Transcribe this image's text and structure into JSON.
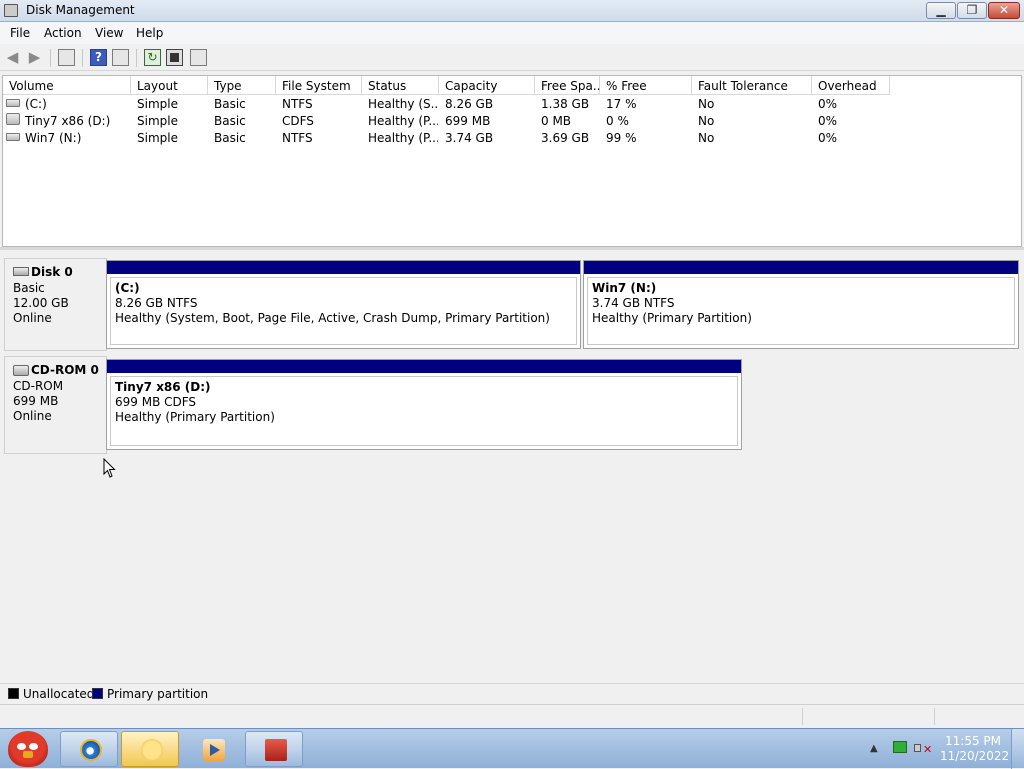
{
  "window": {
    "title": "Disk Management",
    "min_icon": "minimize-icon",
    "max_icon": "maximize-icon",
    "close_icon": "close-icon"
  },
  "menu": [
    "File",
    "Action",
    "View",
    "Help"
  ],
  "toolbar": {
    "icons": [
      "back-arrow-icon",
      "forward-arrow-icon",
      "show-hide-console-tree-icon",
      "help-icon",
      "view-icon",
      "refresh-icon",
      "properties-icon",
      "action-icon"
    ]
  },
  "volume_list": {
    "columns": [
      "Volume",
      "Layout",
      "Type",
      "File System",
      "Status",
      "Capacity",
      "Free Spa...",
      "% Free",
      "Fault Tolerance",
      "Overhead"
    ],
    "rows": [
      {
        "volume": "(C:)",
        "layout": "Simple",
        "type": "Basic",
        "fs": "NTFS",
        "status": "Healthy (S...",
        "capacity": "8.26 GB",
        "free": "1.38 GB",
        "pct": "17 %",
        "fault": "No",
        "overhead": "0%"
      },
      {
        "volume": "Tiny7 x86 (D:)",
        "layout": "Simple",
        "type": "Basic",
        "fs": "CDFS",
        "status": "Healthy (P...",
        "capacity": "699 MB",
        "free": "0 MB",
        "pct": "0 %",
        "fault": "No",
        "overhead": "0%"
      },
      {
        "volume": "Win7 (N:)",
        "layout": "Simple",
        "type": "Basic",
        "fs": "NTFS",
        "status": "Healthy (P...",
        "capacity": "3.74 GB",
        "free": "3.69 GB",
        "pct": "99 %",
        "fault": "No",
        "overhead": "0%"
      }
    ]
  },
  "disks": [
    {
      "name": "Disk 0",
      "kind": "Basic",
      "size": "12.00 GB",
      "state": "Online",
      "partitions": [
        {
          "name": "(C:)",
          "size_fs": "8.26 GB NTFS",
          "status": "Healthy (System, Boot, Page File, Active, Crash Dump, Primary Partition)"
        },
        {
          "name": "Win7  (N:)",
          "size_fs": "3.74 GB NTFS",
          "status": "Healthy (Primary Partition)"
        }
      ]
    },
    {
      "name": "CD-ROM 0",
      "kind": "CD-ROM",
      "size": "699 MB",
      "state": "Online",
      "partitions": [
        {
          "name": "Tiny7 x86  (D:)",
          "size_fs": "699 MB CDFS",
          "status": "Healthy (Primary Partition)"
        }
      ]
    }
  ],
  "legend": [
    {
      "label": "Unallocated",
      "color": "#000000"
    },
    {
      "label": "Primary partition",
      "color": "#000080"
    }
  ],
  "taskbar": {
    "items": [
      "start-orb-icon",
      "internet-explorer-icon",
      "windows-explorer-icon",
      "media-player-icon",
      "computer-management-icon"
    ],
    "clock_time": "11:55 PM",
    "clock_date": "11/20/2022"
  }
}
